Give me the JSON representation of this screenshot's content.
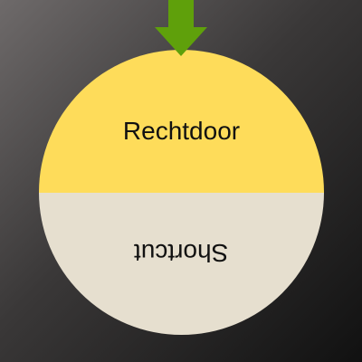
{
  "wheel": {
    "segments": [
      {
        "label": "Rechtdoor",
        "color": "#fedc5a"
      },
      {
        "label": "Shortcut",
        "color": "#e6dfcf"
      }
    ]
  },
  "pointer": {
    "color": "#5fa00b",
    "icon": "down-arrow-icon"
  }
}
